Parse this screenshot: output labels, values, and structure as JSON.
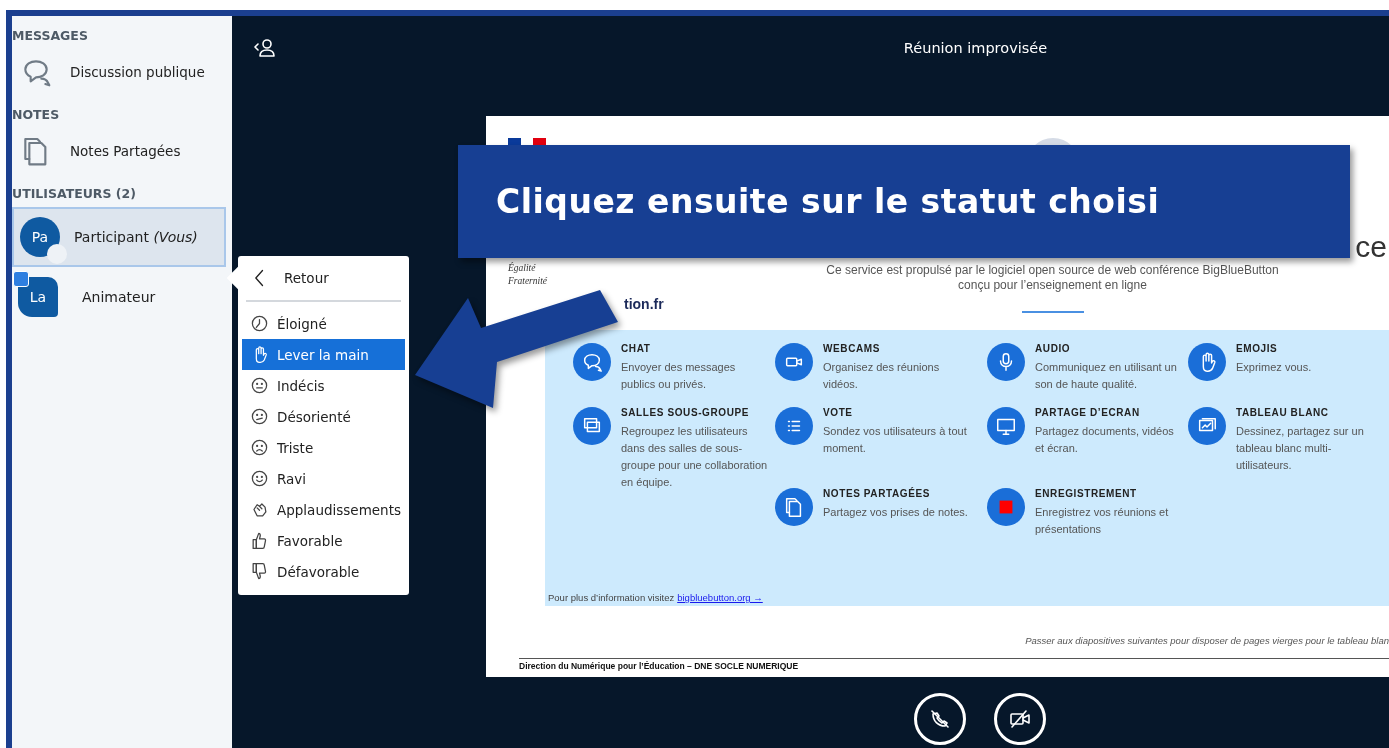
{
  "sidebar": {
    "sections": [
      {
        "heading": "MESSAGES",
        "items": [
          {
            "kind": "chat",
            "label": "Discussion publique"
          }
        ]
      },
      {
        "heading": "NOTES",
        "items": [
          {
            "kind": "notes",
            "label": "Notes Partagées"
          }
        ]
      },
      {
        "heading": "UTILISATEURS (2)",
        "users": [
          {
            "initials": "Pa",
            "name": "Participant *(Vous)*",
            "kind": "viewer",
            "selected": true
          },
          {
            "initials": "La",
            "name": "Animateur",
            "kind": "presenter",
            "selected": false
          }
        ]
      }
    ]
  },
  "header": {
    "title": "Réunion improvisée"
  },
  "status_menu": {
    "back": "Retour",
    "items": [
      {
        "kind": "clock",
        "label": "Éloigné",
        "selected": false
      },
      {
        "kind": "hand",
        "label": "Lever la main",
        "selected": true
      },
      {
        "kind": "neutral",
        "label": "Indécis",
        "selected": false
      },
      {
        "kind": "confused",
        "label": "Désorienté",
        "selected": false
      },
      {
        "kind": "sad",
        "label": "Triste",
        "selected": false
      },
      {
        "kind": "happy",
        "label": "Ravi",
        "selected": false
      },
      {
        "kind": "clap",
        "label": "Applaudissements",
        "selected": false
      },
      {
        "kind": "thumbs-up",
        "label": "Favorable",
        "selected": false
      },
      {
        "kind": "thumbs-down",
        "label": "Défavorable",
        "selected": false
      }
    ]
  },
  "slide": {
    "motto": [
      "Égalité",
      "Fraternité"
    ],
    "logo_text": "tion.fr",
    "title_fragment": "ce",
    "subtitle": "Ce service est propulsé par le logiciel open source de web conférence BigBlueButton\nconçu pour l’enseignement en ligne",
    "features": [
      {
        "kind": "chat",
        "title": "CHAT",
        "text": "Envoyer des messages publics ou privés."
      },
      {
        "kind": "webcam",
        "title": "WEBCAMS",
        "text": "Organisez des réunions vidéos."
      },
      {
        "kind": "mic",
        "title": "AUDIO",
        "text": "Communiquez en utilisant un son de haute qualité."
      },
      {
        "kind": "hand",
        "title": "EMOJIS",
        "text": "Exprimez vous."
      },
      {
        "kind": "rooms",
        "title": "SALLES SOUS-GROUPE",
        "text": "Regroupez les utilisateurs dans des salles de sous-groupe pour une collaboration en équipe."
      },
      {
        "kind": "list",
        "title": "VOTE",
        "text": "Sondez vos utilisateurs à tout moment."
      },
      {
        "kind": "screen",
        "title": "PARTAGE D’ECRAN",
        "text": "Partagez documents, vidéos et écran."
      },
      {
        "kind": "board",
        "title": "TABLEAU BLANC",
        "text": "Dessinez, partagez sur un tableau blanc multi-utilisateurs."
      },
      {
        "kind": "notes",
        "title": "NOTES PARTAGÉES",
        "text": "Partagez vos prises de notes."
      },
      {
        "kind": "record",
        "title": "ENREGISTREMENT",
        "text": "Enregistrez vos réunions et présentations"
      }
    ],
    "info": "Pour plus d’information visitez",
    "link": "bigbluebutton.org →",
    "note": "Passer aux diapositives suivantes pour disposer de pages vierges pour le tableau blan",
    "footer": "Direction du Numérique pour l’Éducation – DNE SOCLE NUMERIQUE"
  },
  "controls": [
    {
      "kind": "audio-off"
    },
    {
      "kind": "video-off"
    }
  ],
  "banner": {
    "text": "Cliquez ensuite sur le statut choisi"
  }
}
